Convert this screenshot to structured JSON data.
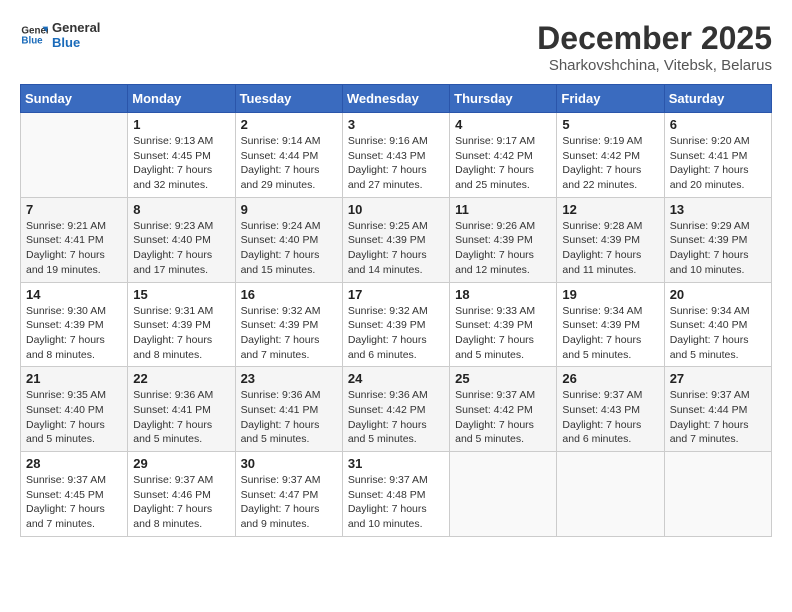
{
  "logo": {
    "line1": "General",
    "line2": "Blue"
  },
  "title": "December 2025",
  "subtitle": "Sharkovshchina, Vitebsk, Belarus",
  "weekdays": [
    "Sunday",
    "Monday",
    "Tuesday",
    "Wednesday",
    "Thursday",
    "Friday",
    "Saturday"
  ],
  "weeks": [
    [
      {
        "day": "",
        "info": ""
      },
      {
        "day": "1",
        "info": "Sunrise: 9:13 AM\nSunset: 4:45 PM\nDaylight: 7 hours\nand 32 minutes."
      },
      {
        "day": "2",
        "info": "Sunrise: 9:14 AM\nSunset: 4:44 PM\nDaylight: 7 hours\nand 29 minutes."
      },
      {
        "day": "3",
        "info": "Sunrise: 9:16 AM\nSunset: 4:43 PM\nDaylight: 7 hours\nand 27 minutes."
      },
      {
        "day": "4",
        "info": "Sunrise: 9:17 AM\nSunset: 4:42 PM\nDaylight: 7 hours\nand 25 minutes."
      },
      {
        "day": "5",
        "info": "Sunrise: 9:19 AM\nSunset: 4:42 PM\nDaylight: 7 hours\nand 22 minutes."
      },
      {
        "day": "6",
        "info": "Sunrise: 9:20 AM\nSunset: 4:41 PM\nDaylight: 7 hours\nand 20 minutes."
      }
    ],
    [
      {
        "day": "7",
        "info": "Sunrise: 9:21 AM\nSunset: 4:41 PM\nDaylight: 7 hours\nand 19 minutes."
      },
      {
        "day": "8",
        "info": "Sunrise: 9:23 AM\nSunset: 4:40 PM\nDaylight: 7 hours\nand 17 minutes."
      },
      {
        "day": "9",
        "info": "Sunrise: 9:24 AM\nSunset: 4:40 PM\nDaylight: 7 hours\nand 15 minutes."
      },
      {
        "day": "10",
        "info": "Sunrise: 9:25 AM\nSunset: 4:39 PM\nDaylight: 7 hours\nand 14 minutes."
      },
      {
        "day": "11",
        "info": "Sunrise: 9:26 AM\nSunset: 4:39 PM\nDaylight: 7 hours\nand 12 minutes."
      },
      {
        "day": "12",
        "info": "Sunrise: 9:28 AM\nSunset: 4:39 PM\nDaylight: 7 hours\nand 11 minutes."
      },
      {
        "day": "13",
        "info": "Sunrise: 9:29 AM\nSunset: 4:39 PM\nDaylight: 7 hours\nand 10 minutes."
      }
    ],
    [
      {
        "day": "14",
        "info": "Sunrise: 9:30 AM\nSunset: 4:39 PM\nDaylight: 7 hours\nand 8 minutes."
      },
      {
        "day": "15",
        "info": "Sunrise: 9:31 AM\nSunset: 4:39 PM\nDaylight: 7 hours\nand 8 minutes."
      },
      {
        "day": "16",
        "info": "Sunrise: 9:32 AM\nSunset: 4:39 PM\nDaylight: 7 hours\nand 7 minutes."
      },
      {
        "day": "17",
        "info": "Sunrise: 9:32 AM\nSunset: 4:39 PM\nDaylight: 7 hours\nand 6 minutes."
      },
      {
        "day": "18",
        "info": "Sunrise: 9:33 AM\nSunset: 4:39 PM\nDaylight: 7 hours\nand 5 minutes."
      },
      {
        "day": "19",
        "info": "Sunrise: 9:34 AM\nSunset: 4:39 PM\nDaylight: 7 hours\nand 5 minutes."
      },
      {
        "day": "20",
        "info": "Sunrise: 9:34 AM\nSunset: 4:40 PM\nDaylight: 7 hours\nand 5 minutes."
      }
    ],
    [
      {
        "day": "21",
        "info": "Sunrise: 9:35 AM\nSunset: 4:40 PM\nDaylight: 7 hours\nand 5 minutes."
      },
      {
        "day": "22",
        "info": "Sunrise: 9:36 AM\nSunset: 4:41 PM\nDaylight: 7 hours\nand 5 minutes."
      },
      {
        "day": "23",
        "info": "Sunrise: 9:36 AM\nSunset: 4:41 PM\nDaylight: 7 hours\nand 5 minutes."
      },
      {
        "day": "24",
        "info": "Sunrise: 9:36 AM\nSunset: 4:42 PM\nDaylight: 7 hours\nand 5 minutes."
      },
      {
        "day": "25",
        "info": "Sunrise: 9:37 AM\nSunset: 4:42 PM\nDaylight: 7 hours\nand 5 minutes."
      },
      {
        "day": "26",
        "info": "Sunrise: 9:37 AM\nSunset: 4:43 PM\nDaylight: 7 hours\nand 6 minutes."
      },
      {
        "day": "27",
        "info": "Sunrise: 9:37 AM\nSunset: 4:44 PM\nDaylight: 7 hours\nand 7 minutes."
      }
    ],
    [
      {
        "day": "28",
        "info": "Sunrise: 9:37 AM\nSunset: 4:45 PM\nDaylight: 7 hours\nand 7 minutes."
      },
      {
        "day": "29",
        "info": "Sunrise: 9:37 AM\nSunset: 4:46 PM\nDaylight: 7 hours\nand 8 minutes."
      },
      {
        "day": "30",
        "info": "Sunrise: 9:37 AM\nSunset: 4:47 PM\nDaylight: 7 hours\nand 9 minutes."
      },
      {
        "day": "31",
        "info": "Sunrise: 9:37 AM\nSunset: 4:48 PM\nDaylight: 7 hours\nand 10 minutes."
      },
      {
        "day": "",
        "info": ""
      },
      {
        "day": "",
        "info": ""
      },
      {
        "day": "",
        "info": ""
      }
    ]
  ]
}
